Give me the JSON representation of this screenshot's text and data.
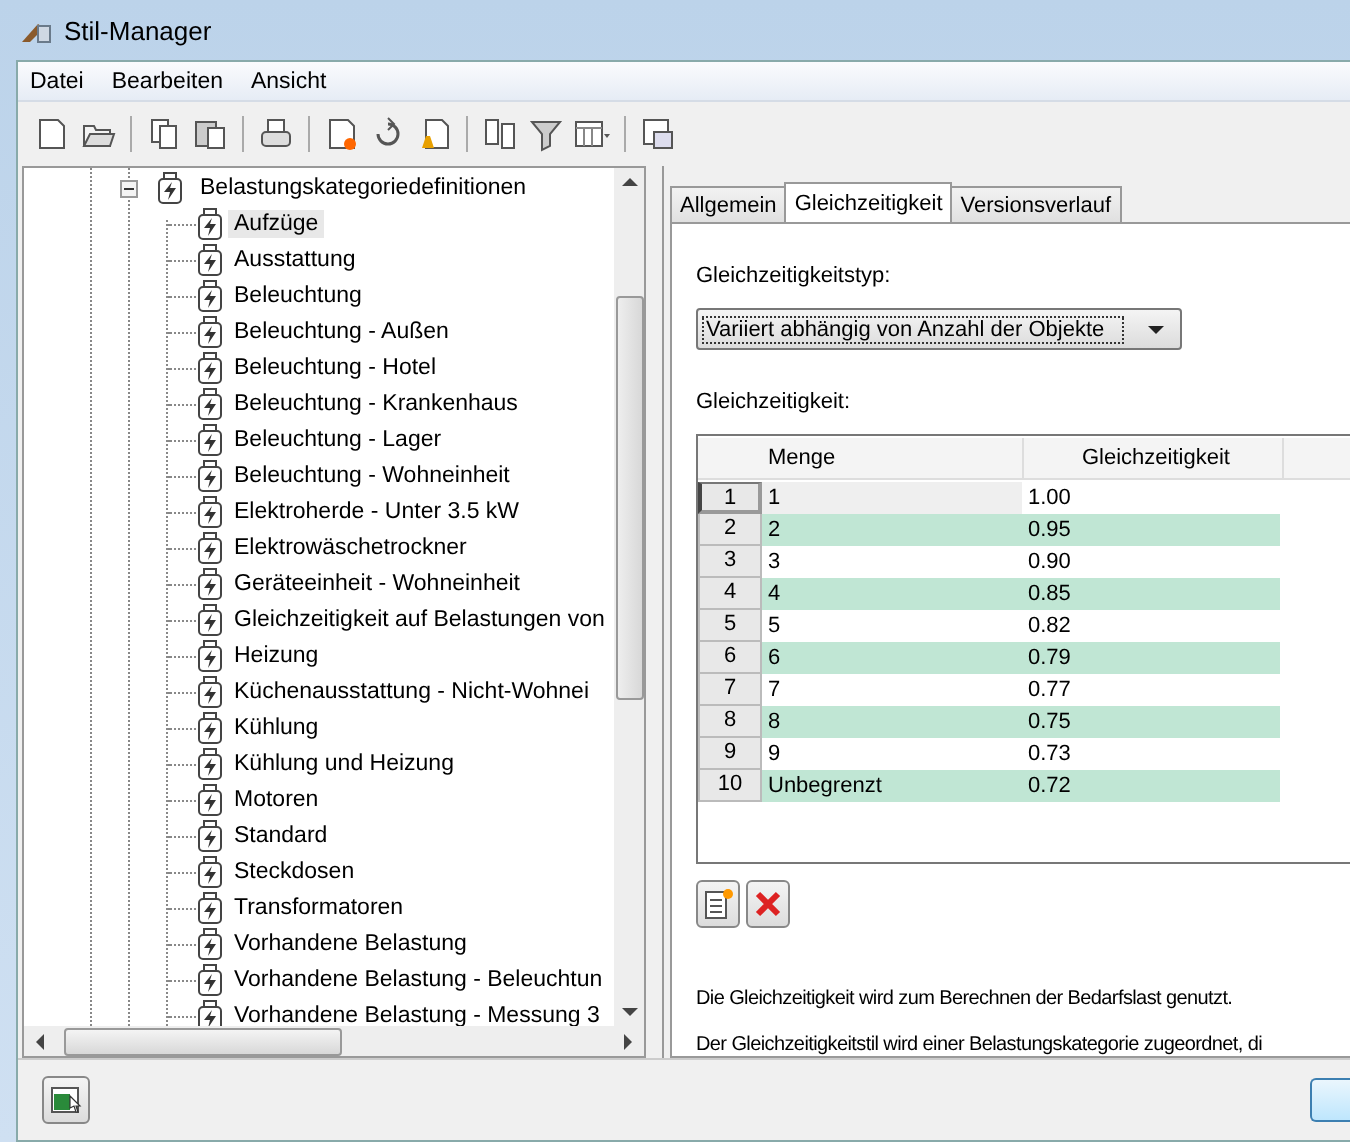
{
  "window": {
    "title": "Stil-Manager"
  },
  "menu": [
    "Datei",
    "Bearbeiten",
    "Ansicht"
  ],
  "tree": {
    "label": "Belastungskategoriedefinitionen",
    "expanded": true,
    "children": [
      {
        "label": "Aufzüge",
        "selected": true
      },
      {
        "label": "Ausstattung",
        "selected": false
      },
      {
        "label": "Beleuchtung",
        "selected": false
      },
      {
        "label": "Beleuchtung - Außen",
        "selected": false
      },
      {
        "label": "Beleuchtung - Hotel",
        "selected": false
      },
      {
        "label": "Beleuchtung - Krankenhaus",
        "selected": false
      },
      {
        "label": "Beleuchtung - Lager",
        "selected": false
      },
      {
        "label": "Beleuchtung - Wohneinheit",
        "selected": false
      },
      {
        "label": "Elektroherde - Unter 3.5 kW",
        "selected": false
      },
      {
        "label": "Elektrowäschetrockner",
        "selected": false
      },
      {
        "label": "Geräteeinheit - Wohneinheit",
        "selected": false
      },
      {
        "label": "Gleichzeitigkeit auf Belastungen von",
        "selected": false
      },
      {
        "label": "Heizung",
        "selected": false
      },
      {
        "label": "Küchenausstattung - Nicht-Wohnei",
        "selected": false
      },
      {
        "label": "Kühlung",
        "selected": false
      },
      {
        "label": "Kühlung und Heizung",
        "selected": false
      },
      {
        "label": "Motoren",
        "selected": false
      },
      {
        "label": "Standard",
        "selected": false
      },
      {
        "label": "Steckdosen",
        "selected": false
      },
      {
        "label": "Transformatoren",
        "selected": false
      },
      {
        "label": "Vorhandene Belastung",
        "selected": false
      },
      {
        "label": "Vorhandene Belastung - Beleuchtun",
        "selected": false
      },
      {
        "label": "Vorhandene Belastung - Messung 3",
        "selected": false
      }
    ]
  },
  "tabs": [
    {
      "label": "Allgemein",
      "selected": false
    },
    {
      "label": "Gleichzeitigkeit",
      "selected": true
    },
    {
      "label": "Versionsverlauf",
      "selected": false
    }
  ],
  "panel": {
    "type_label": "Gleichzeitigkeitstyp:",
    "type_value": "Variiert abhängig von Anzahl der Objekte",
    "grid_label": "Gleichzeitigkeit:",
    "columns": [
      "Menge",
      "Gleichzeitigkeit"
    ],
    "rows": [
      {
        "number": "1",
        "quantity": "1",
        "factor": "1.00",
        "selected": true
      },
      {
        "number": "2",
        "quantity": "2",
        "factor": "0.95",
        "selected": false
      },
      {
        "number": "3",
        "quantity": "3",
        "factor": "0.90",
        "selected": false
      },
      {
        "number": "4",
        "quantity": "4",
        "factor": "0.85",
        "selected": false
      },
      {
        "number": "5",
        "quantity": "5",
        "factor": "0.82",
        "selected": false
      },
      {
        "number": "6",
        "quantity": "6",
        "factor": "0.79",
        "selected": false
      },
      {
        "number": "7",
        "quantity": "7",
        "factor": "0.77",
        "selected": false
      },
      {
        "number": "8",
        "quantity": "8",
        "factor": "0.75",
        "selected": false
      },
      {
        "number": "9",
        "quantity": "9",
        "factor": "0.73",
        "selected": false
      },
      {
        "number": "10",
        "quantity": "Unbegrenzt",
        "factor": "0.72",
        "selected": false
      }
    ],
    "notes": [
      "Die Gleichzeitigkeit wird zum Berechnen der Bedarfslast genutzt.",
      "Der Gleichzeitigkeitstil wird einer Belastungskategorie zugeordnet, di"
    ]
  }
}
